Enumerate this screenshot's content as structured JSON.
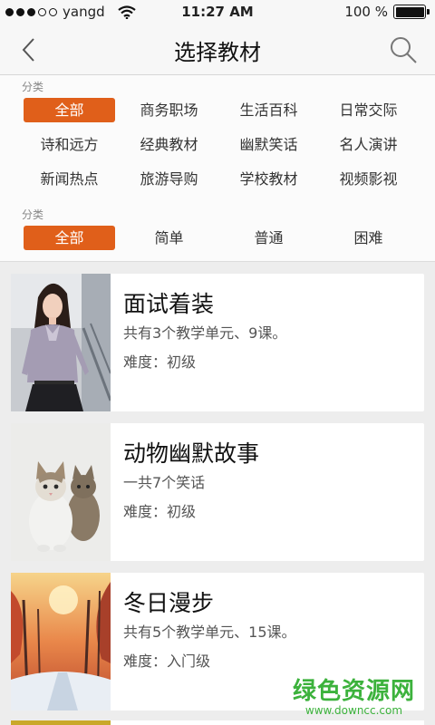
{
  "status_bar": {
    "carrier": "yangd",
    "time": "11:27 AM",
    "battery": "100 %"
  },
  "header": {
    "title": "选择教材"
  },
  "filters": {
    "category_label": "分类",
    "categories": [
      "全部",
      "商务职场",
      "生活百科",
      "日常交际",
      "诗和远方",
      "经典教材",
      "幽默笑话",
      "名人演讲",
      "新闻热点",
      "旅游导购",
      "学校教材",
      "视频影视"
    ],
    "difficulty_label": "分类",
    "difficulties": [
      "全部",
      "简单",
      "普通",
      "困难"
    ],
    "active_color": "#e05f1a"
  },
  "courses": [
    {
      "title": "面试着装",
      "desc": "共有3个教学单元、9课。",
      "level": "难度：初级"
    },
    {
      "title": "动物幽默故事",
      "desc": "一共7个笑话",
      "level": "难度：初级"
    },
    {
      "title": "冬日漫步",
      "desc": "共有5个教学单元、15课。",
      "level": "难度：入门级"
    }
  ],
  "watermark": {
    "main": "绿色资源网",
    "sub": "www.downcc.com"
  }
}
